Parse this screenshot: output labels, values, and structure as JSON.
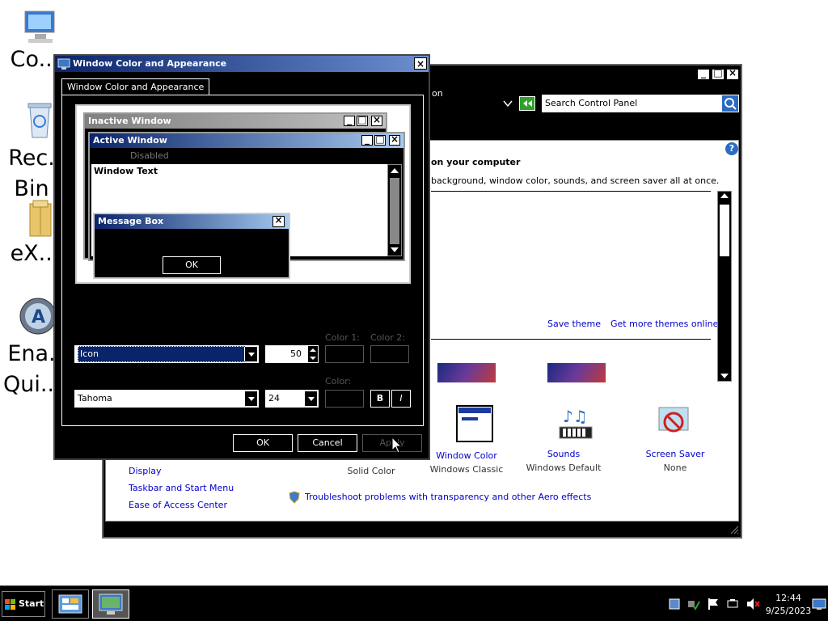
{
  "desktop": {
    "icons": [
      {
        "label": "Co..."
      },
      {
        "label": "Rec. Bin"
      },
      {
        "label": "eX..."
      },
      {
        "label": "Ena. Qui..."
      }
    ]
  },
  "control_panel": {
    "address_fragment": "on",
    "search_placeholder": "Search Control Panel",
    "heading_fragment": "on your computer",
    "description_fragment": "background, window color, sounds, and screen saver all at once.",
    "save_theme": "Save theme",
    "get_more_themes": "Get more themes online",
    "see_also": [
      "Display",
      "Taskbar and Start Menu",
      "Ease of Access Center"
    ],
    "bottom_items": [
      {
        "title": "",
        "subtitle": "Solid Color"
      },
      {
        "title": "Window Color",
        "subtitle": "Windows Classic"
      },
      {
        "title": "Sounds",
        "subtitle": "Windows Default"
      },
      {
        "title": "Screen Saver",
        "subtitle": "None"
      }
    ],
    "troubleshoot": "Troubleshoot problems with transparency and other Aero effects"
  },
  "dialog": {
    "title": "Window Color and Appearance",
    "tab": "Window Color and Appearance",
    "preview": {
      "inactive": "Inactive Window",
      "active": "Active Window",
      "disabled": "Disabled",
      "window_text": "Window Text",
      "message_box": "Message Box",
      "ok": "OK"
    },
    "item_label_color1": "Color 1:",
    "item_label_color2": "Color 2:",
    "item_value": "Icon",
    "size_value": "50",
    "font_label_color": "Color:",
    "font_value": "Tahoma",
    "font_size_value": "24",
    "bold": "B",
    "italic": "I",
    "ok": "OK",
    "cancel": "Cancel",
    "apply": "Apply"
  },
  "taskbar": {
    "start": "Start",
    "time": "12:44",
    "date": "9/25/2023"
  }
}
